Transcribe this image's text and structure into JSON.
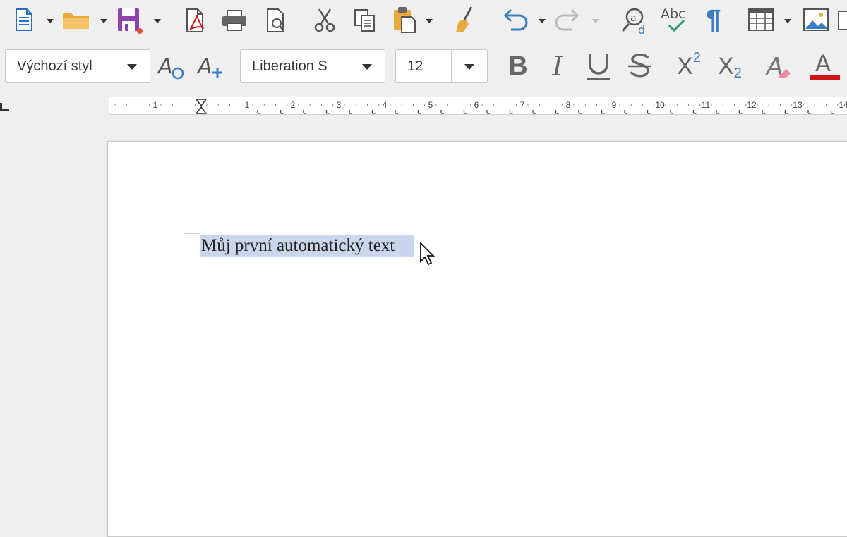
{
  "toolbar_standard": {
    "icons": [
      "new-document-icon",
      "open-folder-icon",
      "save-icon",
      "export-pdf-icon",
      "print-icon",
      "print-preview-icon",
      "cut-icon",
      "copy-icon",
      "paste-icon",
      "clone-formatting-icon",
      "undo-icon",
      "redo-icon",
      "find-replace-icon",
      "spellcheck-icon",
      "formatting-marks-icon",
      "insert-table-icon",
      "insert-image-icon"
    ],
    "spellcheck_label": "Abc",
    "pilcrow": "¶"
  },
  "toolbar_formatting": {
    "paragraph_style": "Výchozí styl",
    "font_name": "Liberation S",
    "font_size": "12",
    "superscript_label": "X",
    "superscript_exp": "2",
    "subscript_label": "X",
    "subscript_exp": "2"
  },
  "ruler": {
    "labels": [
      "1",
      "1",
      "2",
      "3",
      "4",
      "5",
      "6",
      "7",
      "8",
      "9",
      "10",
      "11",
      "12",
      "13",
      "14"
    ]
  },
  "document": {
    "text": "Můj první automatický text"
  },
  "colors": {
    "save_purple": "#8e44ad",
    "accent_blue": "#3b7dc4",
    "font_color_red": "#d0121b",
    "selection_bg": "#c9d6ec",
    "selection_border": "#5c79c9"
  }
}
